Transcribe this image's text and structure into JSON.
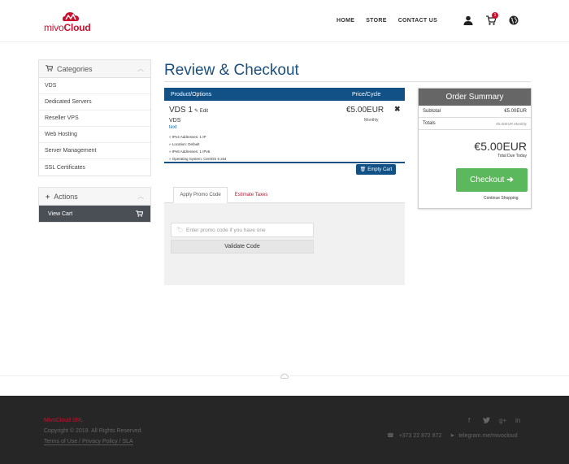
{
  "brand": {
    "logo_prefix": "mivo",
    "logo_suffix": "Cloud",
    "accent_color": "#c8102e"
  },
  "nav": {
    "items": [
      "HOME",
      "STORE",
      "CONTACT US"
    ],
    "cart_count": "1"
  },
  "sidebar": {
    "categories_title": "Categories",
    "categories": [
      "VDS",
      "Dedicated Servers",
      "Reseller VPS",
      "Web Hosting",
      "Server Management",
      "SSL Certificates"
    ],
    "actions_title": "Actions",
    "view_cart": "View Cart"
  },
  "main": {
    "title": "Review & Checkout",
    "table": {
      "col_product": "Product/Options",
      "col_price": "Price/Cycle",
      "item": {
        "name": "VDS 1",
        "edit_label": "Edit",
        "group": "VDS",
        "text": "text",
        "options": [
          "» IPv4 Addresses: 1 IP",
          "» Location: Default",
          "» IPv6 Addresses: 1 IPv6",
          "» Operating System: CentOS 6 x64"
        ],
        "price": "€5.00EUR",
        "cycle": "Monthly",
        "remove": "✖"
      },
      "empty_cart": "Empty Cart"
    },
    "tabs": {
      "promo": "Apply Promo Code",
      "taxes": "Estimate Taxes",
      "promo_placeholder": "Enter promo code if you have one",
      "validate": "Validate Code"
    }
  },
  "summary": {
    "title": "Order Summary",
    "subtotal_label": "Subtotal",
    "subtotal_value": "€5.00EUR",
    "totals_label": "Totals",
    "totals_value": "€5.00EUR Monthly",
    "total_due": "€5.00EUR",
    "total_due_label": "Total Due Today",
    "checkout": "Checkout",
    "continue": "Continue Shopping"
  },
  "footer": {
    "brand": "MivoCloud SRL",
    "copyright": "Copyright © 2019. All Rights Reserved.",
    "links": "Terms of Use / Privacy Policy / SLA",
    "phone": "+373 22 872 872",
    "telegram": "telegram.me/mivocloud",
    "social": [
      "facebook-icon",
      "twitter-icon",
      "google-plus-icon",
      "linkedin-icon"
    ]
  }
}
